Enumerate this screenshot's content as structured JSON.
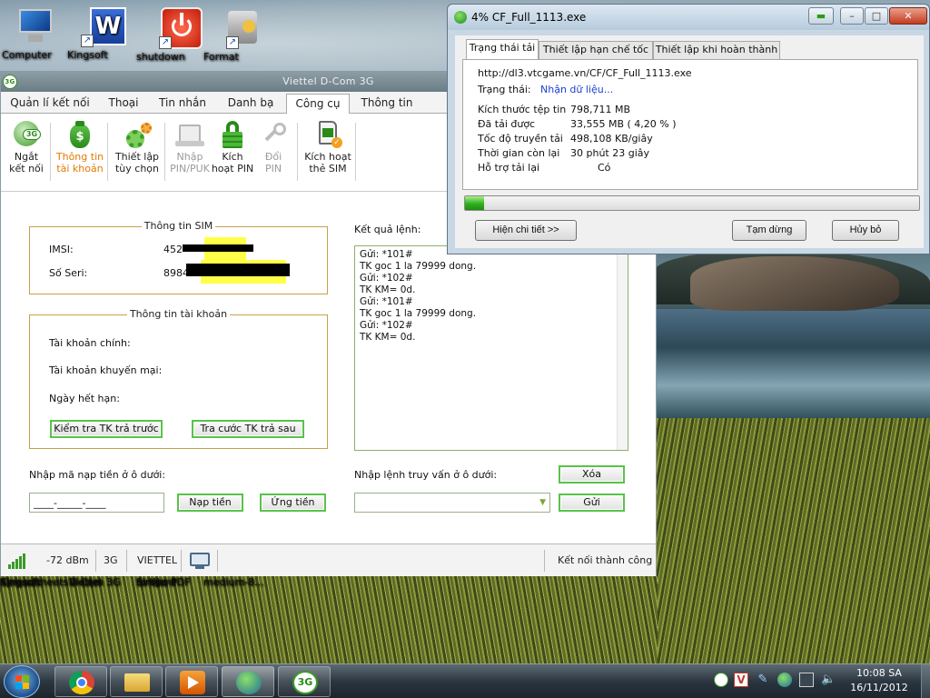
{
  "desktop": {
    "icons_top": [
      {
        "label": "Computer"
      },
      {
        "label": "Kingsoft"
      },
      {
        "label": "shutdown"
      },
      {
        "label": "Format"
      }
    ],
    "icons_bottom": [
      {
        "label_lines": [
          "Kingsoft",
          "Spreadsheets"
        ]
      },
      {
        "label_lines": [
          "Viettel",
          "D-Com 3G"
        ]
      },
      {
        "label_lines": [
          "Simpo PDF",
          "to Word"
        ]
      },
      {
        "label_lines": [
          "medium-8...",
          ""
        ]
      }
    ]
  },
  "dcom": {
    "title": "Viettel D-Com 3G",
    "logo_text": "3G",
    "menu": [
      "Quản lí kết nối",
      "Thoại",
      "Tin nhắn",
      "Danh bạ",
      "Công cụ",
      "Thông tin"
    ],
    "active_menu": "Công cụ",
    "ribbon": [
      {
        "line1": "Ngắt",
        "line2": "kết nối",
        "state": "normal"
      },
      {
        "line1": "Thông tin",
        "line2": "tài khoản",
        "state": "active"
      },
      {
        "line1": "Thiết lập",
        "line2": "tùy chọn",
        "state": "normal"
      },
      {
        "line1": "Nhập",
        "line2": "PIN/PUK",
        "state": "disabled"
      },
      {
        "line1": "Kích",
        "line2": "hoạt PIN",
        "state": "normal"
      },
      {
        "line1": "Đổi",
        "line2": "PIN",
        "state": "disabled"
      },
      {
        "line1": "Kích hoạt",
        "line2": "thẻ SIM",
        "state": "normal"
      }
    ],
    "sim": {
      "title": "Thông tin SIM",
      "imsi_label": "IMSI:",
      "imsi_value": "452",
      "serial_label": "Số Seri:",
      "serial_value": "8984"
    },
    "account": {
      "title": "Thông tin tài khoản",
      "main_label": "Tài khoản chính:",
      "promo_label": "Tài khoản khuyến mại:",
      "expiry_label": "Ngày hết hạn:",
      "check_prepaid_button": "Kiểm tra TK trả trước",
      "check_postpaid_button": "Tra cước TK trả sau"
    },
    "topup": {
      "label": "Nhập mã nạp tiền ở ô dưới:",
      "value": "____-_____-____",
      "topup_button": "Nạp tiền",
      "advance_button": "Ứng tiền"
    },
    "result": {
      "label": "Kết quả lệnh:",
      "lines": [
        "Gửi: *101#",
        "TK goc 1 la 79999 dong.",
        "Gửi: *102#",
        "TK KM= 0d.",
        "Gửi: *101#",
        "TK goc 1 la 79999 dong.",
        "Gửi: *102#",
        "TK KM= 0d."
      ],
      "clear_button": "Xóa"
    },
    "query": {
      "label": "Nhập lệnh truy vấn ở ô dưới:",
      "value": "",
      "send_button": "Gửi"
    },
    "status": {
      "signal": "-72 dBm",
      "network_type": "3G",
      "operator": "VIETTEL",
      "connection": "Kết nối thành công"
    }
  },
  "download": {
    "title": "4% CF_Full_1113.exe",
    "tabs": [
      "Trạng thái tải",
      "Thiết lập hạn chế tốc độ",
      "Thiết lập khi hoàn thành tải"
    ],
    "url": "http://dl3.vtcgame.vn/CF/CF_Full_1113.exe",
    "status_label": "Trạng thái:",
    "status_value": "Nhận dữ liệu...",
    "rows": [
      {
        "label": "Kích thước tệp tin",
        "value": "798,711  MB"
      },
      {
        "label": "Đã tải được",
        "value": "33,555  MB  ( 4,20 % )"
      },
      {
        "label": "Tốc độ truyền tải",
        "value": "498,108  KB/giây"
      },
      {
        "label": "Thời gian còn lại",
        "value": "30 phút 23 giây"
      },
      {
        "label": "Hỗ trợ tải lại",
        "value": "Có"
      }
    ],
    "progress_percent": 4.2,
    "details_button": "Hiện chi tiết >>",
    "pause_button": "Tạm dừng",
    "cancel_button": "Hủy bỏ",
    "win_buttons": {
      "minimize": "–",
      "maximize": "□",
      "close": "✕"
    }
  },
  "taskbar": {
    "clock_time": "10:08 SA",
    "clock_date": "16/11/2012",
    "dcom_app_text": "3G"
  },
  "colors": {
    "accent_green": "#59c24a",
    "group_border": "#c8a04a",
    "active_orange": "#e07b00",
    "progress_green": "#2fb01e",
    "link_blue": "#1d3fd0"
  }
}
